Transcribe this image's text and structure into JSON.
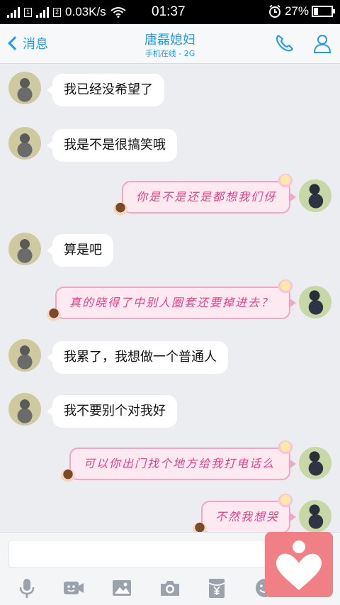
{
  "status_bar": {
    "network_speed": "0.03K/s",
    "time": "01:37",
    "battery": "27%",
    "battery_level": 0.27,
    "sim1": "1",
    "sim2": "2"
  },
  "header": {
    "back_label": "消息",
    "contact_name": "唐磊媳妇",
    "contact_status": "手机在线 - 2G"
  },
  "messages": [
    {
      "side": "left",
      "text": "我已经没希望了"
    },
    {
      "side": "left",
      "text": "我是不是很搞笑哦"
    },
    {
      "side": "right",
      "text": "你是不是还是都想我们伢"
    },
    {
      "side": "left",
      "text": "算是吧"
    },
    {
      "side": "right",
      "text": "真的晓得了中别人圈套还要掉进去？"
    },
    {
      "side": "left",
      "text": "我累了，我想做一个普通人"
    },
    {
      "side": "left",
      "text": "我不要别个对我好"
    },
    {
      "side": "right",
      "text": "可以你出门找个地方给我打电话么"
    },
    {
      "side": "right",
      "text": "不然我想哭"
    }
  ],
  "input": {
    "value": ""
  },
  "toolbar": [
    "microphone-icon",
    "video-face-icon",
    "image-icon",
    "camera-icon",
    "red-packet-icon",
    "emoji-icon"
  ],
  "colors": {
    "accent": "#1d9cf0",
    "bubble_pink_text": "#e7418a",
    "heart_button": "#f07f86"
  }
}
